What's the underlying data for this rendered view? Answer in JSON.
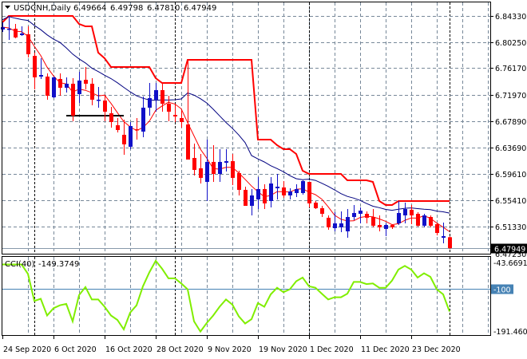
{
  "header": {
    "symbol": "USDCNH,Daily",
    "open": "6.49664",
    "high": "6.49798",
    "low": "6.47810",
    "close": "6.47949",
    "menu_icon": "triangle-down-icon"
  },
  "colors": {
    "bull": "#1010c8",
    "bear": "#ff0000",
    "ma_fast": "#ff0000",
    "ma_slow": "#000080",
    "channel": "#ff0000",
    "cci": "#80ee00",
    "level": "#4682b4",
    "grid": "#778899"
  },
  "chart_data": [
    {
      "type": "candlestick",
      "title": "USDCNH,Daily",
      "ylim": [
        6.4723,
        6.8683
      ],
      "price_ticks": [
        "6.84330",
        "6.80250",
        "6.76170",
        "6.71970",
        "6.67890",
        "6.63690",
        "6.59610",
        "6.55410",
        "6.51330"
      ],
      "current_price": "6.47949",
      "hidden_tick": "6.47230",
      "x_labels": [
        "24 Sep 2020",
        "6 Oct 2020",
        "16 Oct 2020",
        "28 Oct 2020",
        "9 Nov 2020",
        "19 Nov 2020",
        "1 Dec 2020",
        "11 Dec 2020",
        "23 Dec 2020"
      ],
      "x_label_bars": [
        0,
        8,
        16,
        24,
        32,
        40,
        48,
        56,
        64
      ],
      "month_separator_bars": [
        5,
        27,
        48,
        70
      ],
      "support_line": {
        "price": 6.6871,
        "from_bar": 10,
        "to_bar": 19
      },
      "ohlc": [
        [
          6.8221,
          6.8333,
          6.8183,
          6.8258
        ],
        [
          6.8221,
          6.8433,
          6.8058,
          6.8233
        ],
        [
          6.8233,
          6.8308,
          6.8083,
          6.8096
        ],
        [
          6.8133,
          6.8271,
          6.8121,
          6.8158
        ],
        [
          6.8146,
          6.8271,
          6.7783,
          6.7833
        ],
        [
          6.7808,
          6.7858,
          6.7283,
          6.7471
        ],
        [
          6.7483,
          6.7771,
          6.7446,
          6.7508
        ],
        [
          6.7483,
          6.7533,
          6.7121,
          6.7183
        ],
        [
          6.7158,
          6.7483,
          6.7146,
          6.7471
        ],
        [
          6.7446,
          6.7533,
          6.7183,
          6.7308
        ],
        [
          6.7308,
          6.7471,
          6.7233,
          6.7371
        ],
        [
          6.7371,
          6.7458,
          6.6783,
          6.6871
        ],
        [
          6.7208,
          6.7558,
          6.7071,
          6.7421
        ],
        [
          6.7433,
          6.7633,
          6.7283,
          6.7371
        ],
        [
          6.7371,
          6.7458,
          6.7033,
          6.7121
        ],
        [
          6.7108,
          6.7321,
          6.6996,
          6.7121
        ],
        [
          6.7108,
          6.7196,
          6.6783,
          6.6933
        ],
        [
          6.6908,
          6.7008,
          6.6683,
          6.6771
        ],
        [
          6.6721,
          6.6833,
          6.6608,
          6.6646
        ],
        [
          6.6571,
          6.6808,
          6.6258,
          6.6421
        ],
        [
          6.6383,
          6.6771,
          6.6346,
          6.6708
        ],
        [
          6.6658,
          6.6833,
          6.6496,
          6.6646
        ],
        [
          6.6621,
          6.7171,
          6.6533,
          6.6996
        ],
        [
          6.6996,
          6.7383,
          6.6871,
          6.7146
        ],
        [
          6.7121,
          6.7383,
          6.6933,
          6.7271
        ],
        [
          6.7271,
          6.7383,
          6.6933,
          6.7058
        ],
        [
          6.7058,
          6.7183,
          6.6783,
          6.6933
        ],
        [
          6.6883,
          6.7058,
          6.6771,
          6.6858
        ],
        [
          6.6833,
          6.6958,
          6.6683,
          6.6771
        ],
        [
          6.6733,
          6.7746,
          6.6183,
          6.6183
        ],
        [
          6.6208,
          6.6433,
          6.5933,
          6.6021
        ],
        [
          6.6046,
          6.6271,
          6.5808,
          6.5896
        ],
        [
          6.5833,
          6.6496,
          6.5533,
          6.6146
        ],
        [
          6.6146,
          6.6408,
          6.5833,
          6.5958
        ],
        [
          6.5958,
          6.6346,
          6.5833,
          6.6146
        ],
        [
          6.6133,
          6.6346,
          6.5996,
          6.6158
        ],
        [
          6.6158,
          6.6271,
          6.5783,
          6.5896
        ],
        [
          6.5971,
          6.6008,
          6.5621,
          6.5708
        ],
        [
          6.5708,
          6.5758,
          6.5458,
          6.5458
        ],
        [
          6.5458,
          6.5721,
          6.5308,
          6.5621
        ],
        [
          6.5558,
          6.5908,
          6.5408,
          6.5721
        ],
        [
          6.5721,
          6.5796,
          6.5408,
          6.5496
        ],
        [
          6.5533,
          6.5908,
          6.5433,
          6.5808
        ],
        [
          6.5733,
          6.5958,
          6.5558,
          6.5758
        ],
        [
          6.5746,
          6.5846,
          6.5583,
          6.5621
        ],
        [
          6.5621,
          6.5733,
          6.5558,
          6.5683
        ],
        [
          6.5658,
          6.5796,
          6.5596,
          6.5721
        ],
        [
          6.5658,
          6.5858,
          6.5633,
          6.5846
        ],
        [
          6.5833,
          6.5833,
          6.5433,
          6.5496
        ],
        [
          6.5508,
          6.5533,
          6.5408,
          6.5421
        ],
        [
          6.5421,
          6.5458,
          6.5283,
          6.5333
        ],
        [
          6.5271,
          6.5308,
          6.5083,
          6.5121
        ],
        [
          6.5108,
          6.5358,
          6.5058,
          6.5183
        ],
        [
          6.5121,
          6.5371,
          6.5046,
          6.5183
        ],
        [
          6.5058,
          6.5408,
          6.4958,
          6.5283
        ],
        [
          6.5283,
          6.5471,
          6.5233,
          6.5346
        ],
        [
          6.5333,
          6.5433,
          6.5183,
          6.5383
        ],
        [
          6.5333,
          6.5371,
          6.5183,
          6.5271
        ],
        [
          6.5283,
          6.5408,
          6.5121,
          6.5146
        ],
        [
          6.5158,
          6.5308,
          6.5058,
          6.5121
        ],
        [
          6.5096,
          6.5183,
          6.4983,
          6.5158
        ],
        [
          6.5158,
          6.5171,
          6.5096,
          6.5121
        ],
        [
          6.5183,
          6.5533,
          6.5158,
          6.5346
        ],
        [
          6.5308,
          6.5508,
          6.5183,
          6.5408
        ],
        [
          6.5396,
          6.5471,
          6.5171,
          6.5308
        ],
        [
          6.5333,
          6.5358,
          6.5133,
          6.5146
        ],
        [
          6.5146,
          6.5333,
          6.5121,
          6.5308
        ],
        [
          6.5283,
          6.5308,
          6.5121,
          6.5146
        ],
        [
          6.5171,
          6.5183,
          6.4996,
          6.5033
        ],
        [
          6.4958,
          6.5196,
          6.4871,
          6.4983
        ],
        [
          6.49664,
          6.49798,
          6.4781,
          6.47949
        ]
      ]
    },
    {
      "type": "line",
      "title": "CCI(40)",
      "current_value": "-149.3749",
      "ylim": [
        -191.4606,
        -43.6691
      ],
      "tick_top": "-43.6691",
      "tick_bottom": "-191.4606",
      "level": -100,
      "level_label": "-100",
      "values": [
        -47.9,
        -47.9,
        -47.9,
        -47.9,
        -68.3,
        -126.5,
        -121.8,
        -157.9,
        -142.2,
        -135.9,
        -132.8,
        -170.5,
        -113.9,
        -96.6,
        -123.4,
        -123.4,
        -139.1,
        -157.9,
        -167.4,
        -187.8,
        -151.7,
        -135.9,
        -95.1,
        -65.2,
        -40.0,
        -57.3,
        -77.8,
        -77.8,
        -88.8,
        -101.4,
        -170.5,
        -192.5,
        -173.7,
        -157.9,
        -139.1,
        -123.4,
        -134.4,
        -159.5,
        -175.2,
        -165.8,
        -131.2,
        -139.1,
        -112.4,
        -98.2,
        -107.6,
        -101.4,
        -84.1,
        -76.2,
        -95.1,
        -98.2,
        -110.8,
        -123.4,
        -118.6,
        -118.6,
        -110.8,
        -85.6,
        -85.6,
        -90.3,
        -88.8,
        -98.2,
        -98.2,
        -82.5,
        -58.9,
        -51.0,
        -58.9,
        -76.2,
        -66.8,
        -74.6,
        -101.4,
        -112.4,
        -149.4
      ]
    }
  ]
}
